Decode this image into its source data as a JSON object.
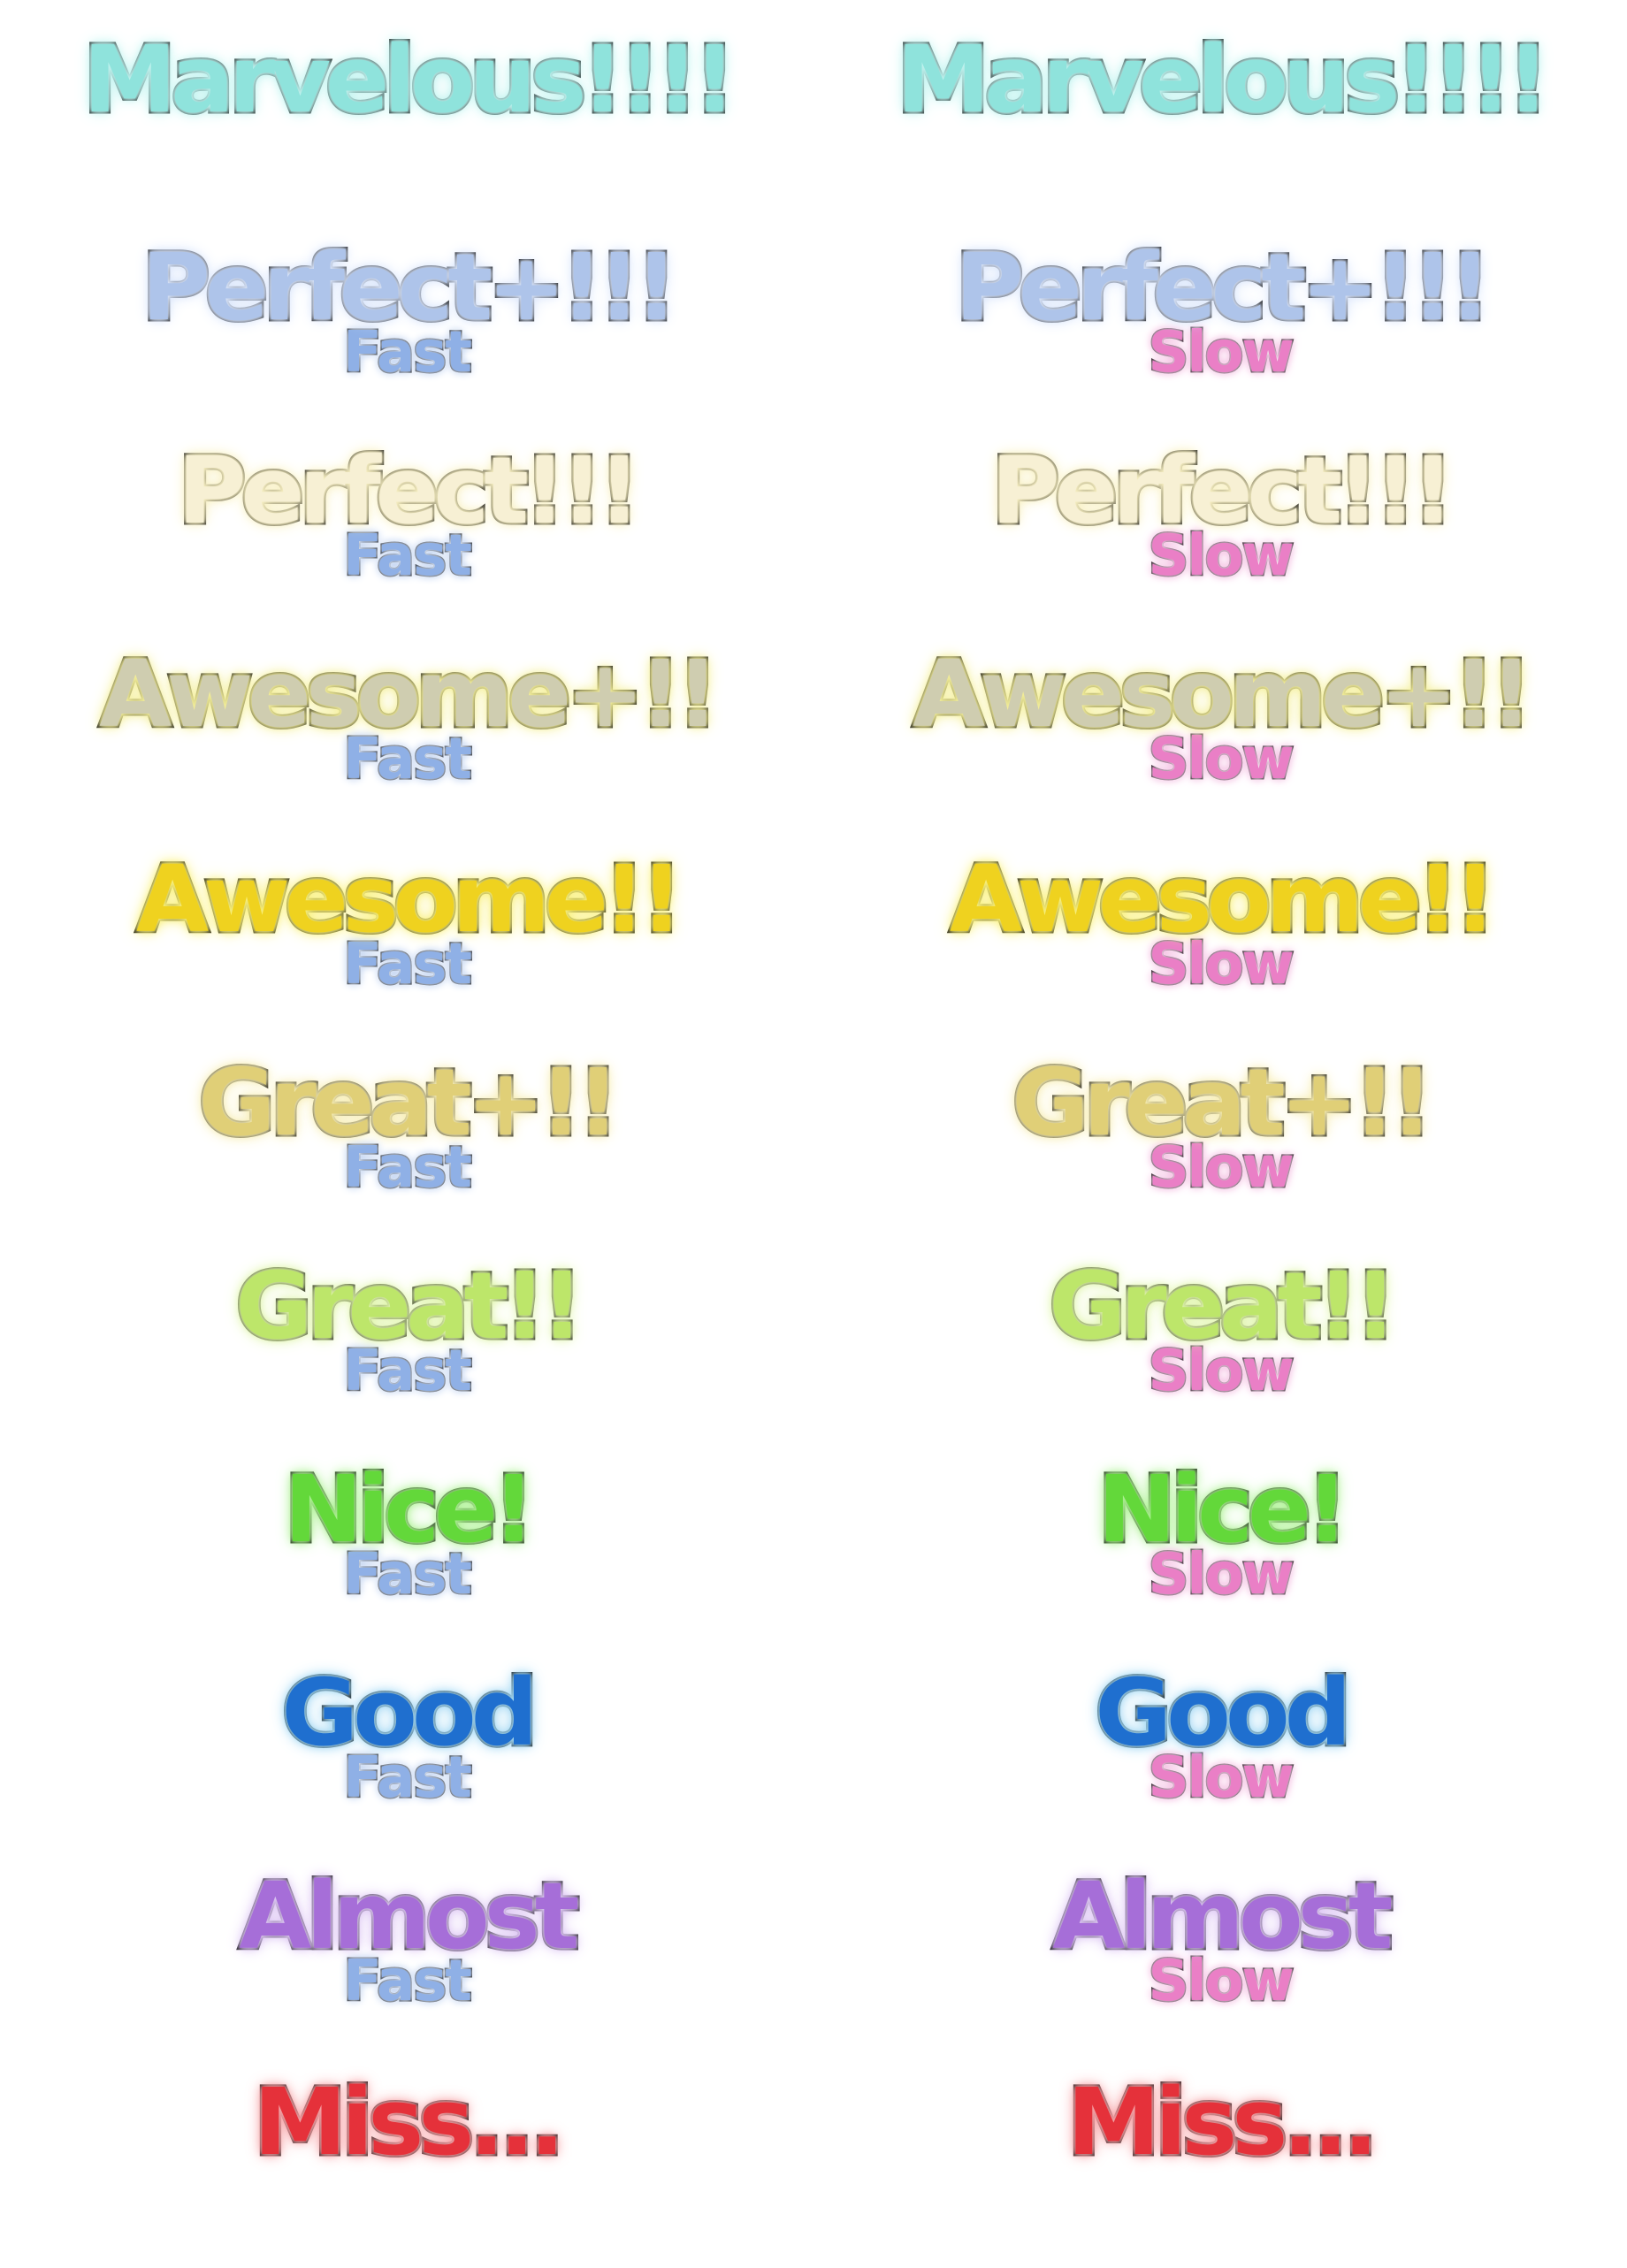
{
  "sheet": {
    "columns": [
      {
        "id": "left",
        "timing_label": "Fast",
        "timing_color": "#8fb0e6"
      },
      {
        "id": "right",
        "timing_label": "Slow",
        "timing_color": "#ea7fc6"
      }
    ],
    "judgements": [
      {
        "id": "marvelous",
        "label": "Marvelous!!!!",
        "fill": "#8fe3dc",
        "glow": "#bff3ef",
        "has_timing": false
      },
      {
        "id": "perfect-plus",
        "label": "Perfect+!!!",
        "fill": "#aec4ea",
        "glow": "#d9e5fb",
        "has_timing": true
      },
      {
        "id": "perfect",
        "label": "Perfect!!!",
        "fill": "#f7f0d4",
        "glow": "#f8f0c2",
        "has_timing": true
      },
      {
        "id": "awesome-plus",
        "label": "Awesome+!!",
        "fill": "#cfcdb0",
        "glow": "#f4ef9a",
        "has_timing": true
      },
      {
        "id": "awesome",
        "label": "Awesome!!",
        "fill": "#efd21f",
        "glow": "#f9f07a",
        "has_timing": true
      },
      {
        "id": "great-plus",
        "label": "Great+!!",
        "fill": "#e0cf77",
        "glow": "#f6ecb0",
        "has_timing": true
      },
      {
        "id": "great",
        "label": "Great!!",
        "fill": "#bde66a",
        "glow": "#def4a8",
        "has_timing": true
      },
      {
        "id": "nice",
        "label": "Nice!",
        "fill": "#63d83a",
        "glow": "#aaf08f",
        "has_timing": true
      },
      {
        "id": "good",
        "label": "Good",
        "fill": "#1f6fcf",
        "glow": "#9fd6f3",
        "has_timing": true
      },
      {
        "id": "almost",
        "label": "Almost",
        "fill": "#a66ed8",
        "glow": "#dcc5f3",
        "has_timing": true
      },
      {
        "id": "miss",
        "label": "Miss...",
        "fill": "#e5313a",
        "glow": "#f6a0a4",
        "has_timing": false
      }
    ]
  }
}
